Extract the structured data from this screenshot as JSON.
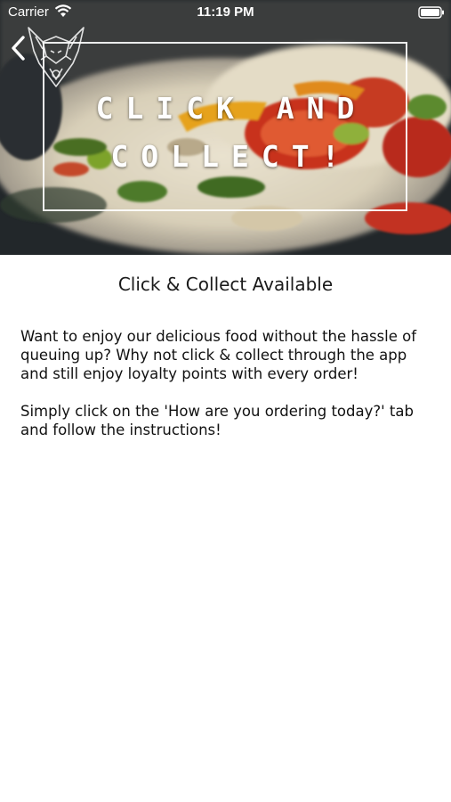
{
  "status_bar": {
    "carrier": "Carrier",
    "time": "11:19 PM",
    "wifi_icon": "wifi-icon",
    "battery_icon": "battery-icon"
  },
  "header": {
    "back_icon": "chevron-left-icon",
    "logo_icon": "wolf-head-logo",
    "banner_line_1": "CLICK AND",
    "banner_line_2": "COLLECT!"
  },
  "main": {
    "title": "Click & Collect Available",
    "paragraphs": [
      "Want to enjoy our delicious food without the hassle of queuing up? Why not click & collect through the app and still enjoy loyalty points with every order!",
      "Simply click on the 'How are you ordering today?' tab and follow the instructions!"
    ]
  },
  "colors": {
    "background": "#ffffff",
    "text": "#111111",
    "banner_text": "#ffffff"
  }
}
